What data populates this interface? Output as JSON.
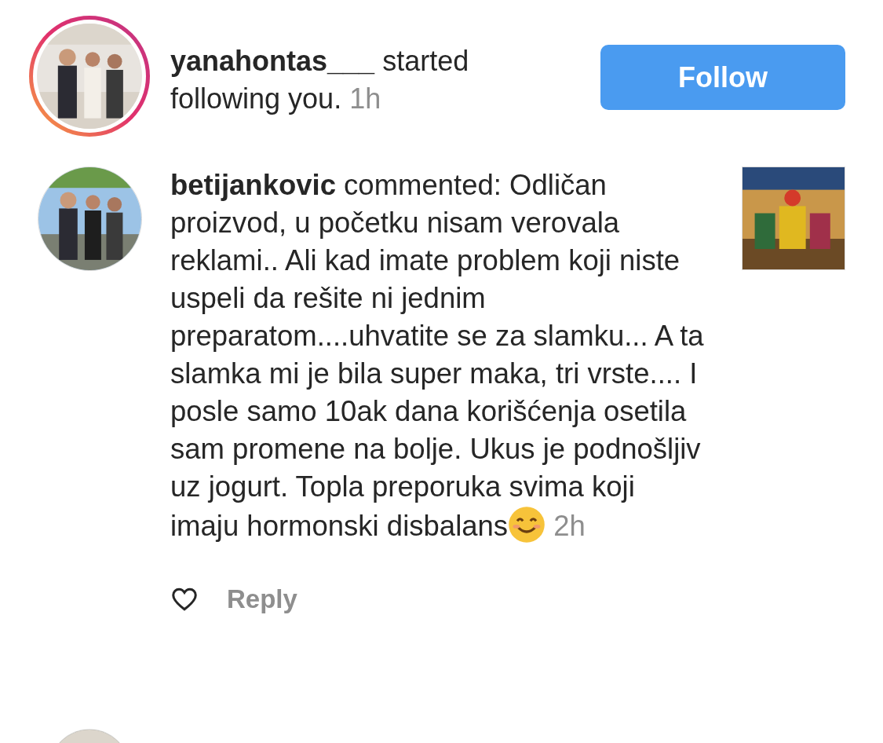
{
  "follow_notification": {
    "text": "**yanahontas___** started following you.",
    "time": "1h",
    "button": "Follow"
  },
  "comment_notification": {
    "text": "**betijankovic** commented: Odličan proizvod, u početku nisam verovala reklami.. Ali kad imate problem koji niste uspeli da rešite ni jednim preparatom....uhvatite se za slamku... A ta slamka mi je bila super maka, tri vrste.... I posle samo 10ak dana korišćenja osetila sam promene na bolje. Ukus je podnošljiv uz jogurt. Topla preporuka svima koji imaju hormonski disbalans",
    "time": "2h",
    "liked": false,
    "reply": "Reply"
  }
}
